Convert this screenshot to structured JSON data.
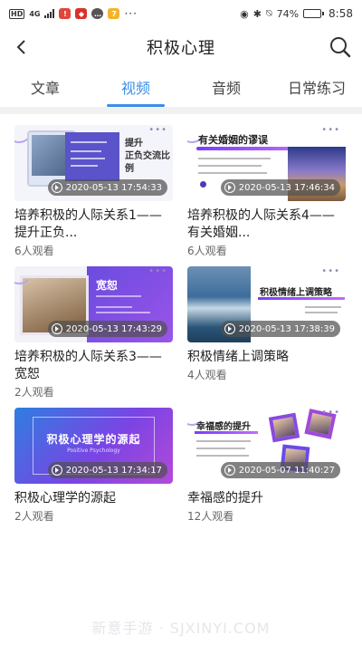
{
  "status_bar": {
    "hd": "HD",
    "network": "4G",
    "battery_percent": "74%",
    "battery_level": 0.74,
    "time": "8:58"
  },
  "header": {
    "title": "积极心理",
    "back_icon": "back-chevron-icon",
    "search_icon": "search-icon"
  },
  "tabs": [
    {
      "label": "文章",
      "active": false
    },
    {
      "label": "视频",
      "active": true
    },
    {
      "label": "音频",
      "active": false
    },
    {
      "label": "日常练习",
      "active": false
    }
  ],
  "colors": {
    "accent": "#3a8ee6",
    "thumb_purple": "#7a44e4"
  },
  "videos": [
    {
      "title": "培养积极的人际关系1——提升正负...",
      "views": "6人观看",
      "timestamp": "2020-05-13 17:54:33",
      "thumb_text": [
        "提升",
        "正负交流比例"
      ]
    },
    {
      "title": "培养积极的人际关系4——有关婚姻...",
      "views": "6人观看",
      "timestamp": "2020-05-13 17:46:34",
      "thumb_text": [
        "有关婚姻的谬误"
      ]
    },
    {
      "title": "培养积极的人际关系3——宽恕",
      "views": "2人观看",
      "timestamp": "2020-05-13 17:43:29",
      "thumb_text": [
        "宽恕"
      ]
    },
    {
      "title": "积极情绪上调策略",
      "views": "4人观看",
      "timestamp": "2020-05-13 17:38:39",
      "thumb_text": [
        "积极情绪上调策略"
      ]
    },
    {
      "title": "积极心理学的源起",
      "views": "2人观看",
      "timestamp": "2020-05-13 17:34:17",
      "thumb_text": [
        "积极心理学的源起",
        "Positive Psychology"
      ]
    },
    {
      "title": "幸福感的提升",
      "views": "12人观看",
      "timestamp": "2020-05-07 11:40:27",
      "thumb_text": [
        "幸福感的提升"
      ]
    }
  ],
  "watermark": "新意手游 · SJXINYI.COM"
}
